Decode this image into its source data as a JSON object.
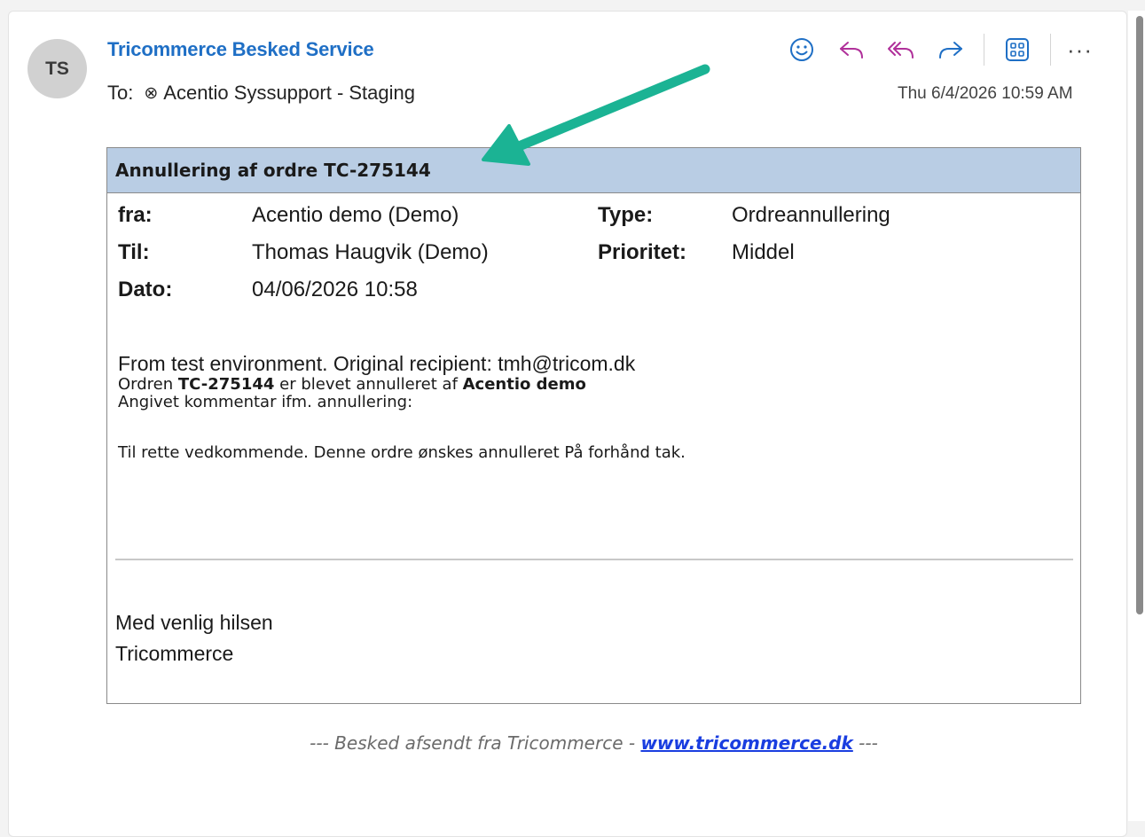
{
  "sender": {
    "initials": "TS",
    "name": "Tricommerce Besked Service",
    "to_prefix": "To:",
    "to_recipient": "Acentio Syssupport - Staging",
    "date": "Thu 6/4/2026 10:59 AM"
  },
  "toolbar": {
    "icons": [
      "emoji-icon",
      "reply-icon",
      "reply-all-icon",
      "forward-icon",
      "apps-icon",
      "more-icon"
    ],
    "more_label": "···"
  },
  "message": {
    "header": "Annullering af ordre TC-275144",
    "fields": {
      "from_label": "fra:",
      "from_value": "Acentio demo (Demo)",
      "to_label": "Til:",
      "to_value": "Thomas Haugvik (Demo)",
      "date_label": "Dato:",
      "date_value": "04/06/2026 10:58",
      "type_label": "Type:",
      "type_value": "Ordreannullering",
      "priority_label": "Prioritet:",
      "priority_value": "Middel"
    },
    "intro": "From test environment. Original recipient: tmh@tricom.dk",
    "line1_pre": "Ordren ",
    "line1_order": "TC-275144",
    "line1_mid": " er blevet annulleret af ",
    "line1_by": "Acentio demo",
    "line2": "Angivet kommentar ifm. annullering:",
    "comment": "Til rette vedkommende. Denne ordre ønskes annulleret På forhånd tak.",
    "signoff_line1": "Med venlig hilsen",
    "signoff_line2": "Tricommerce"
  },
  "footer": {
    "prefix": "--- Besked afsendt fra Tricommerce - ",
    "link": "www.tricommerce.dk",
    "suffix": " ---"
  },
  "colors": {
    "accent_blue": "#1f6fc5",
    "reply_purple": "#b0309a",
    "header_bg": "#b9cde4",
    "annotation_arrow": "#1bb394"
  }
}
